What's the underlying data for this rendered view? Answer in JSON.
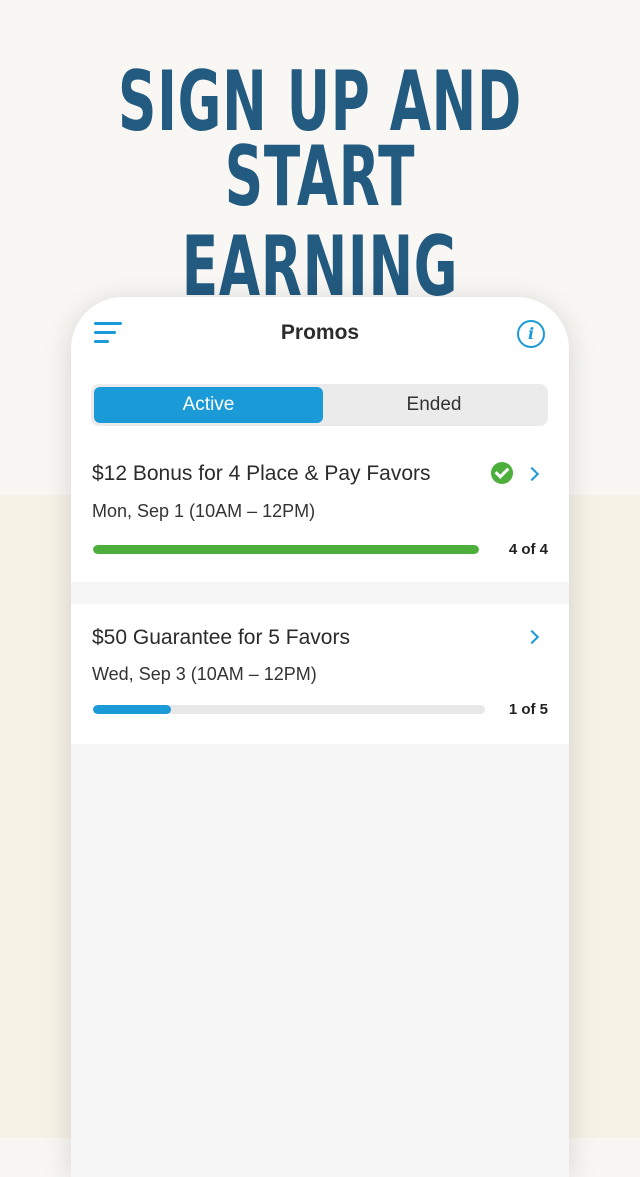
{
  "headline": {
    "line1": "SIGN UP AND",
    "line2": "START EARNING"
  },
  "app": {
    "title": "Promos",
    "menu_icon": "hamburger-menu-icon",
    "info_icon": "info-icon",
    "info_glyph": "i",
    "tabs": [
      {
        "label": "Active",
        "selected": true
      },
      {
        "label": "Ended",
        "selected": false
      }
    ]
  },
  "promos": [
    {
      "title": "$12 Bonus for 4 Place & Pay Favors",
      "date": "Mon, Sep 1  (10AM – 12PM)",
      "completed": true,
      "progress_done": 4,
      "progress_total": 4,
      "progress_label": "4 of 4",
      "bar_color": "#4caf3c"
    },
    {
      "title": "$50 Guarantee for 5 Favors",
      "date": "Wed, Sep 3  (10AM – 12PM)",
      "completed": false,
      "progress_done": 1,
      "progress_total": 5,
      "progress_label": "1 of 5",
      "bar_color": "#1a9ad6"
    }
  ],
  "colors": {
    "headline": "#235a80",
    "accent": "#1a9ad6",
    "success": "#4caf3c"
  }
}
